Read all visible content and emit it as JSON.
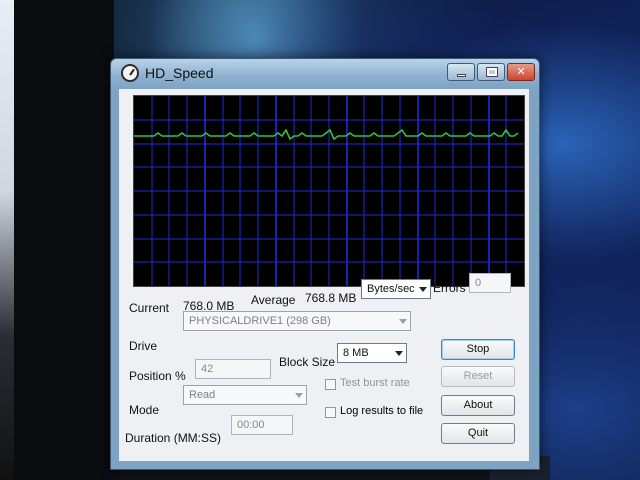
{
  "window": {
    "title": "HD_Speed"
  },
  "titlebar_buttons": {
    "minimize": "minimize-icon",
    "maximize": "maximize-icon",
    "close": "close-icon"
  },
  "graph": {
    "background": "#000000",
    "grid_color": "#1f2bd6",
    "trace_color": "#35c23a"
  },
  "stats": {
    "current_label": "Current",
    "current_value": "768.0 MB",
    "average_label": "Average",
    "average_value": "768.8 MB",
    "unit_value": "Bytes/sec",
    "errors_label": "Errors",
    "errors_value": "0"
  },
  "settings": {
    "drive_label": "Drive",
    "drive_value": "PHYSICALDRIVE1 (298 GB)",
    "position_label": "Position %",
    "position_value": "42",
    "block_size_label": "Block Size",
    "block_size_value": "8 MB",
    "burst_label": "Test burst rate",
    "mode_label": "Mode",
    "mode_value": "Read",
    "log_label": "Log results to file",
    "duration_label": "Duration (MM:SS)",
    "duration_value": "00:00"
  },
  "buttons": {
    "stop": "Stop",
    "reset": "Reset",
    "about": "About",
    "quit": "Quit"
  }
}
